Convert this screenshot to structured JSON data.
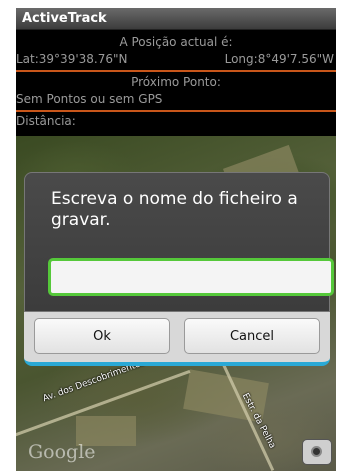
{
  "titlebar": {
    "title": "ActiveTrack"
  },
  "info": {
    "position_header": "A Posição actual é:",
    "lat": "Lat:39°39'38.76\"N",
    "long": "Long:8°49'7.56\"W",
    "next_point_header": "Próximo Ponto:",
    "next_point_value": "Sem Pontos  ou sem GPS",
    "distance_label": "Distância:"
  },
  "map": {
    "road_label_1": "Av. dos Descobrimentos",
    "road_label_2": "Estr. da Pelha",
    "watermark": "Google",
    "camera_icon": "camera-icon"
  },
  "dialog": {
    "message": "Escreva o nome do ficheiro a gravar.",
    "input_value": "",
    "ok_label": "Ok",
    "cancel_label": "Cancel"
  },
  "colors": {
    "separator": "#c9561a",
    "input_focus": "#55c83a",
    "dialog_accent": "#2aa9d6"
  }
}
